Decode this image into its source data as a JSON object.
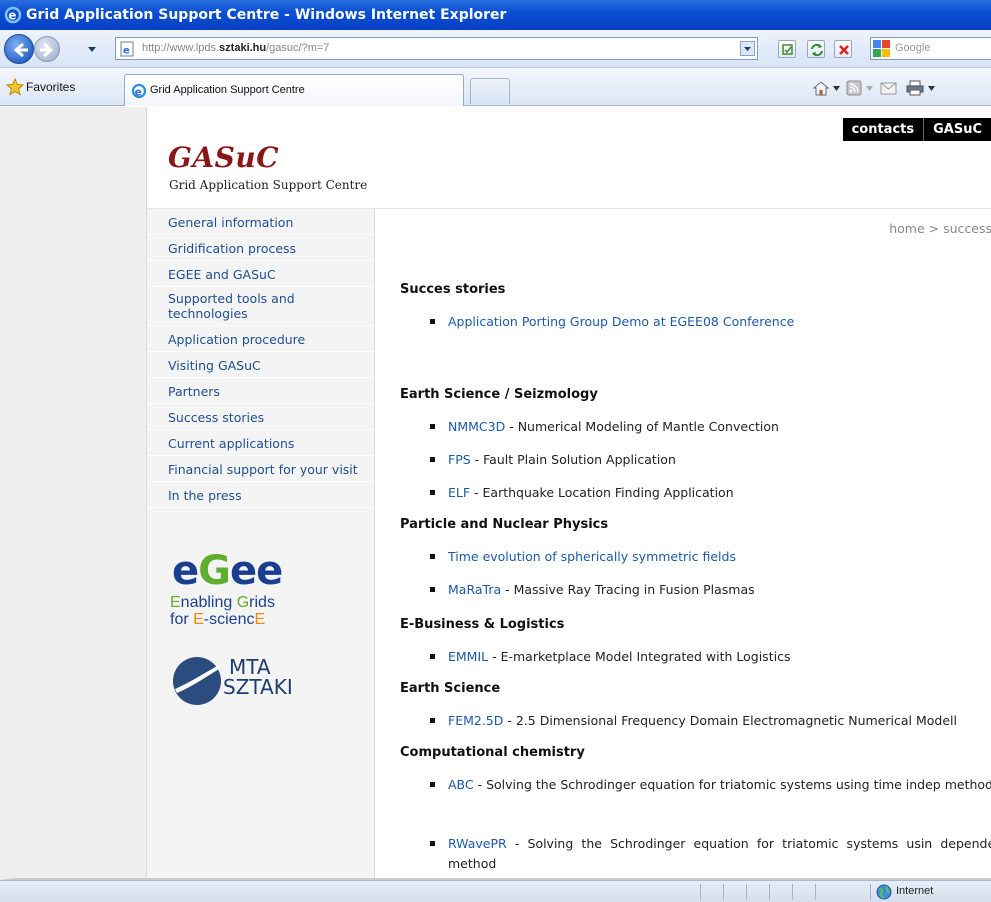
{
  "window": {
    "title": "Grid Application Support Centre - Windows Internet Explorer"
  },
  "address_bar": {
    "url_prefix": "http://www.lpds.",
    "url_domain": "sztaki.hu",
    "url_suffix": "/gasuc/?m=7",
    "search_placeholder": "Google"
  },
  "favorites_bar": {
    "favorites_label": "Favorites",
    "active_tab_title": "Grid Application Support Centre"
  },
  "site": {
    "top_links": [
      "contacts",
      "GASuC"
    ],
    "logo_title": "GASuC",
    "logo_subtitle": "Grid Application Support Centre",
    "breadcrumb": "home > success"
  },
  "sidebar": {
    "items": [
      {
        "label": "General information"
      },
      {
        "label": "Gridification process"
      },
      {
        "label": "EGEE and GASuC"
      },
      {
        "label": "Supported tools and technologies"
      },
      {
        "label": "Application procedure"
      },
      {
        "label": "Visiting GASuC"
      },
      {
        "label": "Partners"
      },
      {
        "label": "Success stories"
      },
      {
        "label": "Current applications"
      },
      {
        "label": "Financial support for your visit"
      },
      {
        "label": "In the press"
      }
    ],
    "egee_logo": {
      "word_e1": "e",
      "word_g": "G",
      "word_ee": "ee",
      "line1_a": "E",
      "line1_b": "nabling ",
      "line1_c": "G",
      "line1_d": "rids",
      "line2_a": "for ",
      "line2_b": "E",
      "line2_c": "-scienc",
      "line2_d": "E"
    },
    "mta_logo": {
      "line1": "MTA",
      "line2": "SZTAKI"
    }
  },
  "content": {
    "sections": [
      {
        "title": "Succes stories",
        "items": [
          {
            "link": "Application Porting Group Demo at EGEE08 Conference",
            "text": ""
          }
        ]
      },
      {
        "title": "Earth Science / Seizmology",
        "items": [
          {
            "link": "NMMC3D",
            "text": " - Numerical Modeling of Mantle Convection"
          },
          {
            "link": "FPS",
            "text": " - Fault Plain Solution Application"
          },
          {
            "link": "ELF",
            "text": " - Earthquake Location Finding Application"
          }
        ]
      },
      {
        "title": "Particle and Nuclear Physics",
        "items": [
          {
            "link": "Time evolution of spherically symmetric fields",
            "text": ""
          },
          {
            "link": "MaRaTra",
            "text": " - Massive Ray Tracing in Fusion Plasmas"
          }
        ]
      },
      {
        "title": "E-Business & Logistics",
        "items": [
          {
            "link": "EMMIL",
            "text": " - E-marketplace Model Integrated with Logistics"
          }
        ]
      },
      {
        "title": "Earth Science",
        "items": [
          {
            "link": "FEM2.5D",
            "text": " - 2.5 Dimensional Frequency Domain Electromagnetic Numerical Modell"
          }
        ]
      },
      {
        "title": "Computational chemistry",
        "items": [
          {
            "link": "ABC",
            "text": " - Solving the Schrodinger equation for triatomic systems using time indep method"
          },
          {
            "link": "RWavePR",
            "text": " - Solving the Schrodinger equation for triatomic systems usin dependent method"
          }
        ]
      }
    ]
  },
  "status_bar": {
    "zone": "Internet"
  },
  "colors": {
    "titlebar": "#0a4fd3",
    "link": "#1d5aa8",
    "logo_red": "#8a1717",
    "egee_blue": "#1b3f8f",
    "egee_green": "#5fae2f",
    "egee_orange": "#f08a00"
  }
}
